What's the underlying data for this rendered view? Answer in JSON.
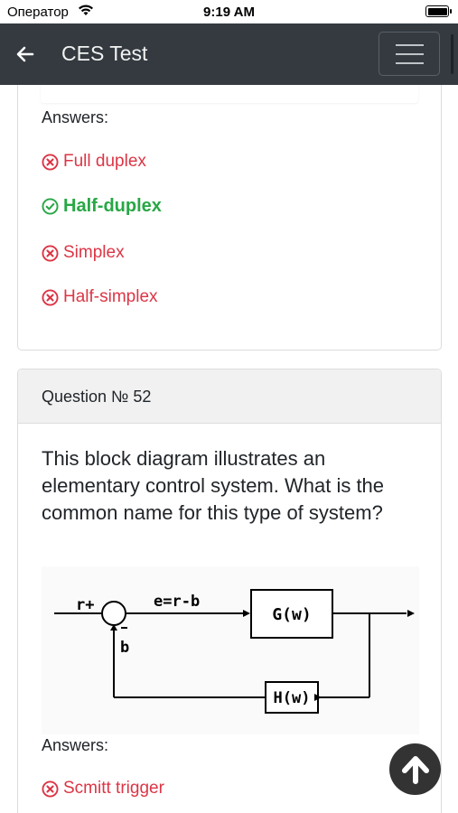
{
  "status_bar": {
    "carrier": "Оператор",
    "time": "9:19 AM"
  },
  "header": {
    "title": "CES Test",
    "back_icon": "arrow-left-icon",
    "menu_icon": "hamburger-menu-icon"
  },
  "previous_question": {
    "answers_label": "Answers:",
    "answers": [
      {
        "text": "Full duplex",
        "correct": false
      },
      {
        "text": "Half-duplex",
        "correct": true
      },
      {
        "text": "Simplex",
        "correct": false
      },
      {
        "text": "Half-simplex",
        "correct": false
      }
    ]
  },
  "question": {
    "header": "Question № 52",
    "text": "This block diagram illustrates an elementary control system. What is the common name for this type of system?",
    "diagram": {
      "input_label": "r+",
      "error_label": "e=r-b",
      "forward_block": "G(w)",
      "feedback_block": "H(w)",
      "feedback_label": "b"
    },
    "answers_label": "Answers:",
    "answers": [
      {
        "text": "Scmitt trigger",
        "correct": false
      }
    ]
  },
  "colors": {
    "correct": "#28a745",
    "wrong": "#dc3545",
    "header_bg": "#343a40"
  }
}
